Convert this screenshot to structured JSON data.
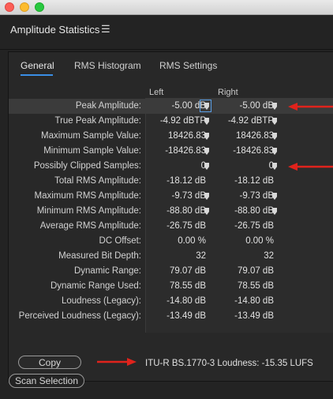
{
  "panel": {
    "title": "Amplitude Statistics",
    "menu_icon": "☰"
  },
  "tabs": [
    {
      "label": "General",
      "active": true
    },
    {
      "label": "RMS Histogram",
      "active": false
    },
    {
      "label": "RMS Settings",
      "active": false
    }
  ],
  "columns": {
    "left": "Left",
    "right": "Right"
  },
  "rows": [
    {
      "label": "Peak Amplitude:",
      "left": "-5.00 dB",
      "right": "-5.00 dB",
      "left_marker": true,
      "right_marker": true,
      "highlight": true,
      "arrow": true
    },
    {
      "label": "True Peak Amplitude:",
      "left": "-4.92 dBTP",
      "right": "-4.92 dBTP",
      "left_marker": true,
      "right_marker": true
    },
    {
      "label": "Maximum Sample Value:",
      "left": "18426.83",
      "right": "18426.83",
      "left_marker": true,
      "right_marker": true
    },
    {
      "label": "Minimum Sample Value:",
      "left": "-18426.83",
      "right": "-18426.83",
      "left_marker": true,
      "right_marker": true
    },
    {
      "label": "Possibly Clipped Samples:",
      "left": "0",
      "right": "0",
      "left_marker": true,
      "right_marker": true,
      "arrow": true
    },
    {
      "label": "Total RMS Amplitude:",
      "left": "-18.12 dB",
      "right": "-18.12 dB"
    },
    {
      "label": "Maximum RMS Amplitude:",
      "left": "-9.73 dB",
      "right": "-9.73 dB",
      "left_marker": true,
      "right_marker": true
    },
    {
      "label": "Minimum RMS Amplitude:",
      "left": "-88.80 dB",
      "right": "-88.80 dB",
      "left_marker": true,
      "right_marker": true
    },
    {
      "label": "Average RMS Amplitude:",
      "left": "-26.75 dB",
      "right": "-26.75 dB"
    },
    {
      "label": "DC Offset:",
      "left": "0.00 %",
      "right": "0.00 %"
    },
    {
      "label": "Measured Bit Depth:",
      "left": "32",
      "right": "32"
    },
    {
      "label": "Dynamic Range:",
      "left": "79.07 dB",
      "right": "79.07 dB"
    },
    {
      "label": "Dynamic Range Used:",
      "left": "78.55 dB",
      "right": "78.55 dB"
    },
    {
      "label": "Loudness (Legacy):",
      "left": "-14.80 dB",
      "right": "-14.80 dB"
    },
    {
      "label": "Perceived Loudness (Legacy):",
      "left": "-13.49 dB",
      "right": "-13.49 dB"
    }
  ],
  "copy_button": "Copy",
  "loudness_text": "ITU-R BS.1770-3 Loudness: -15.35 LUFS",
  "scan_button": "Scan Selection",
  "colors": {
    "accent": "#3a8ee6",
    "arrow": "#e0231c",
    "background": "#232323"
  },
  "icons": {
    "marker": "map-pin-icon",
    "arrow": "red-arrow-icon"
  }
}
